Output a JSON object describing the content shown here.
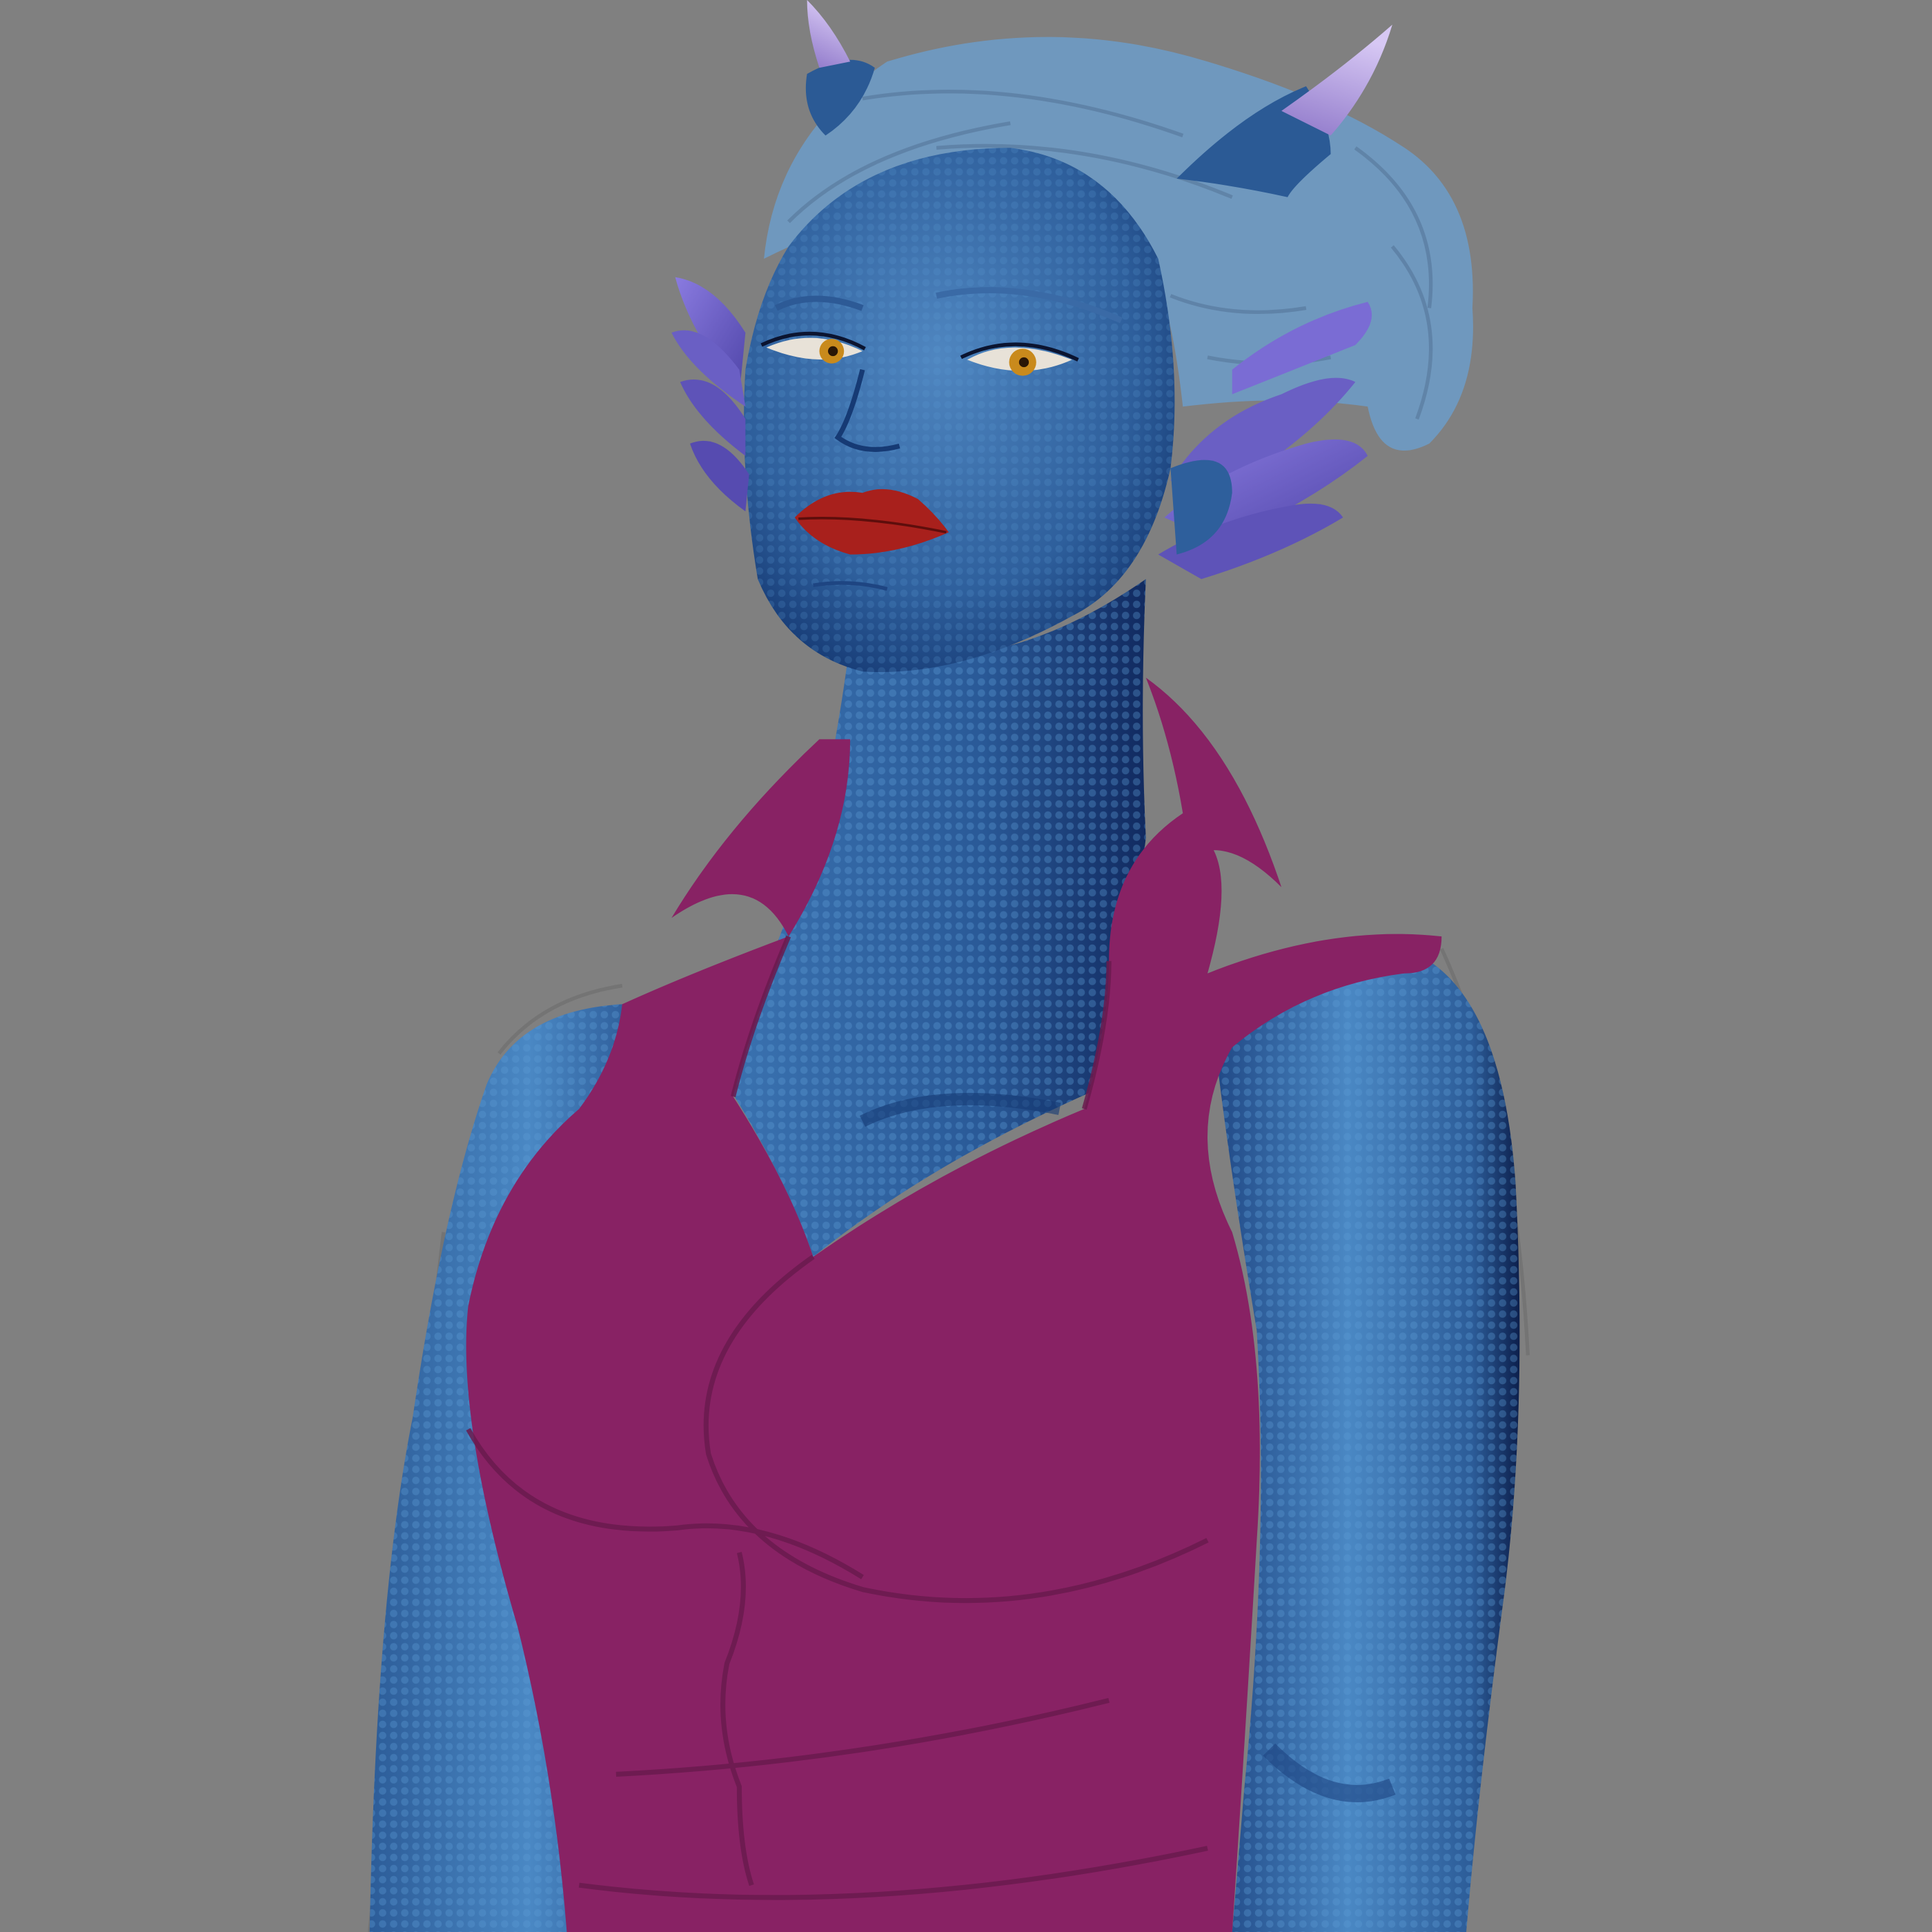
{
  "artwork": {
    "subject": "",
    "colors": {
      "background": "#808080",
      "skin": "#2f5f9c",
      "skin_light": "#4a88c4",
      "skin_shadow": "#10285a",
      "hair": "#6f98be",
      "hair_line": "#5c7fa3",
      "horn": "#b9a3e3",
      "horn_base": "#2b5a95",
      "ear_fin": "#6a5fc4",
      "ear_fin_light": "#8a7be0",
      "lips": "#a8201c",
      "eyes": "#c98a1c",
      "shirt": "#882264",
      "shirt_line": "#6a1a4e",
      "sketch_line": "#6f6f6f"
    }
  }
}
